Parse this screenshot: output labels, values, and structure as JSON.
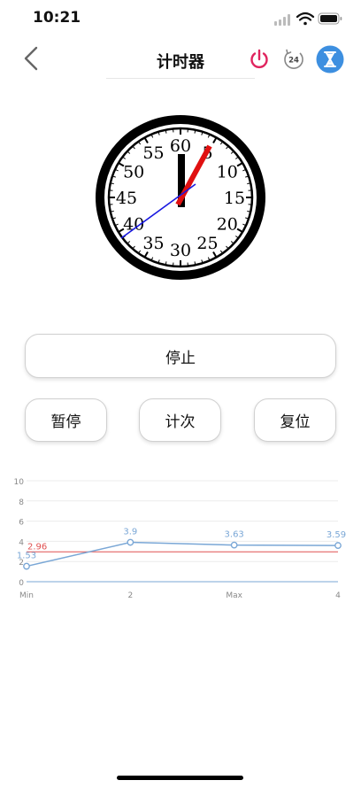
{
  "status_bar": {
    "time": "10:21"
  },
  "nav": {
    "title": "计时器"
  },
  "clock": {
    "numerals": [
      "60",
      "5",
      "10",
      "15",
      "20",
      "25",
      "30",
      "35",
      "40",
      "45",
      "50",
      "55"
    ]
  },
  "buttons": {
    "stop_label": "停止",
    "pause_label": "暂停",
    "lap_label": "计次",
    "reset_label": "复位"
  },
  "colors": {
    "accent_blue": "#4a90d9",
    "power_pink": "#e0245e",
    "clock_red": "#e01010",
    "chart_line": "#7aa7d6",
    "chart_ref": "#e05050"
  },
  "chart_data": {
    "type": "line",
    "categories": [
      "Min",
      "2",
      "Max",
      "4"
    ],
    "series": [
      {
        "values": [
          1.53,
          3.9,
          3.63,
          3.59
        ],
        "labels": [
          "1.53",
          "3.9",
          "3.63",
          "3.59"
        ]
      }
    ],
    "reference_line": {
      "value": 2.96,
      "label": "2.96"
    },
    "y_ticks": [
      "0",
      "2",
      "4",
      "6",
      "8",
      "10"
    ],
    "ylim": [
      0,
      10
    ],
    "grid": true
  }
}
